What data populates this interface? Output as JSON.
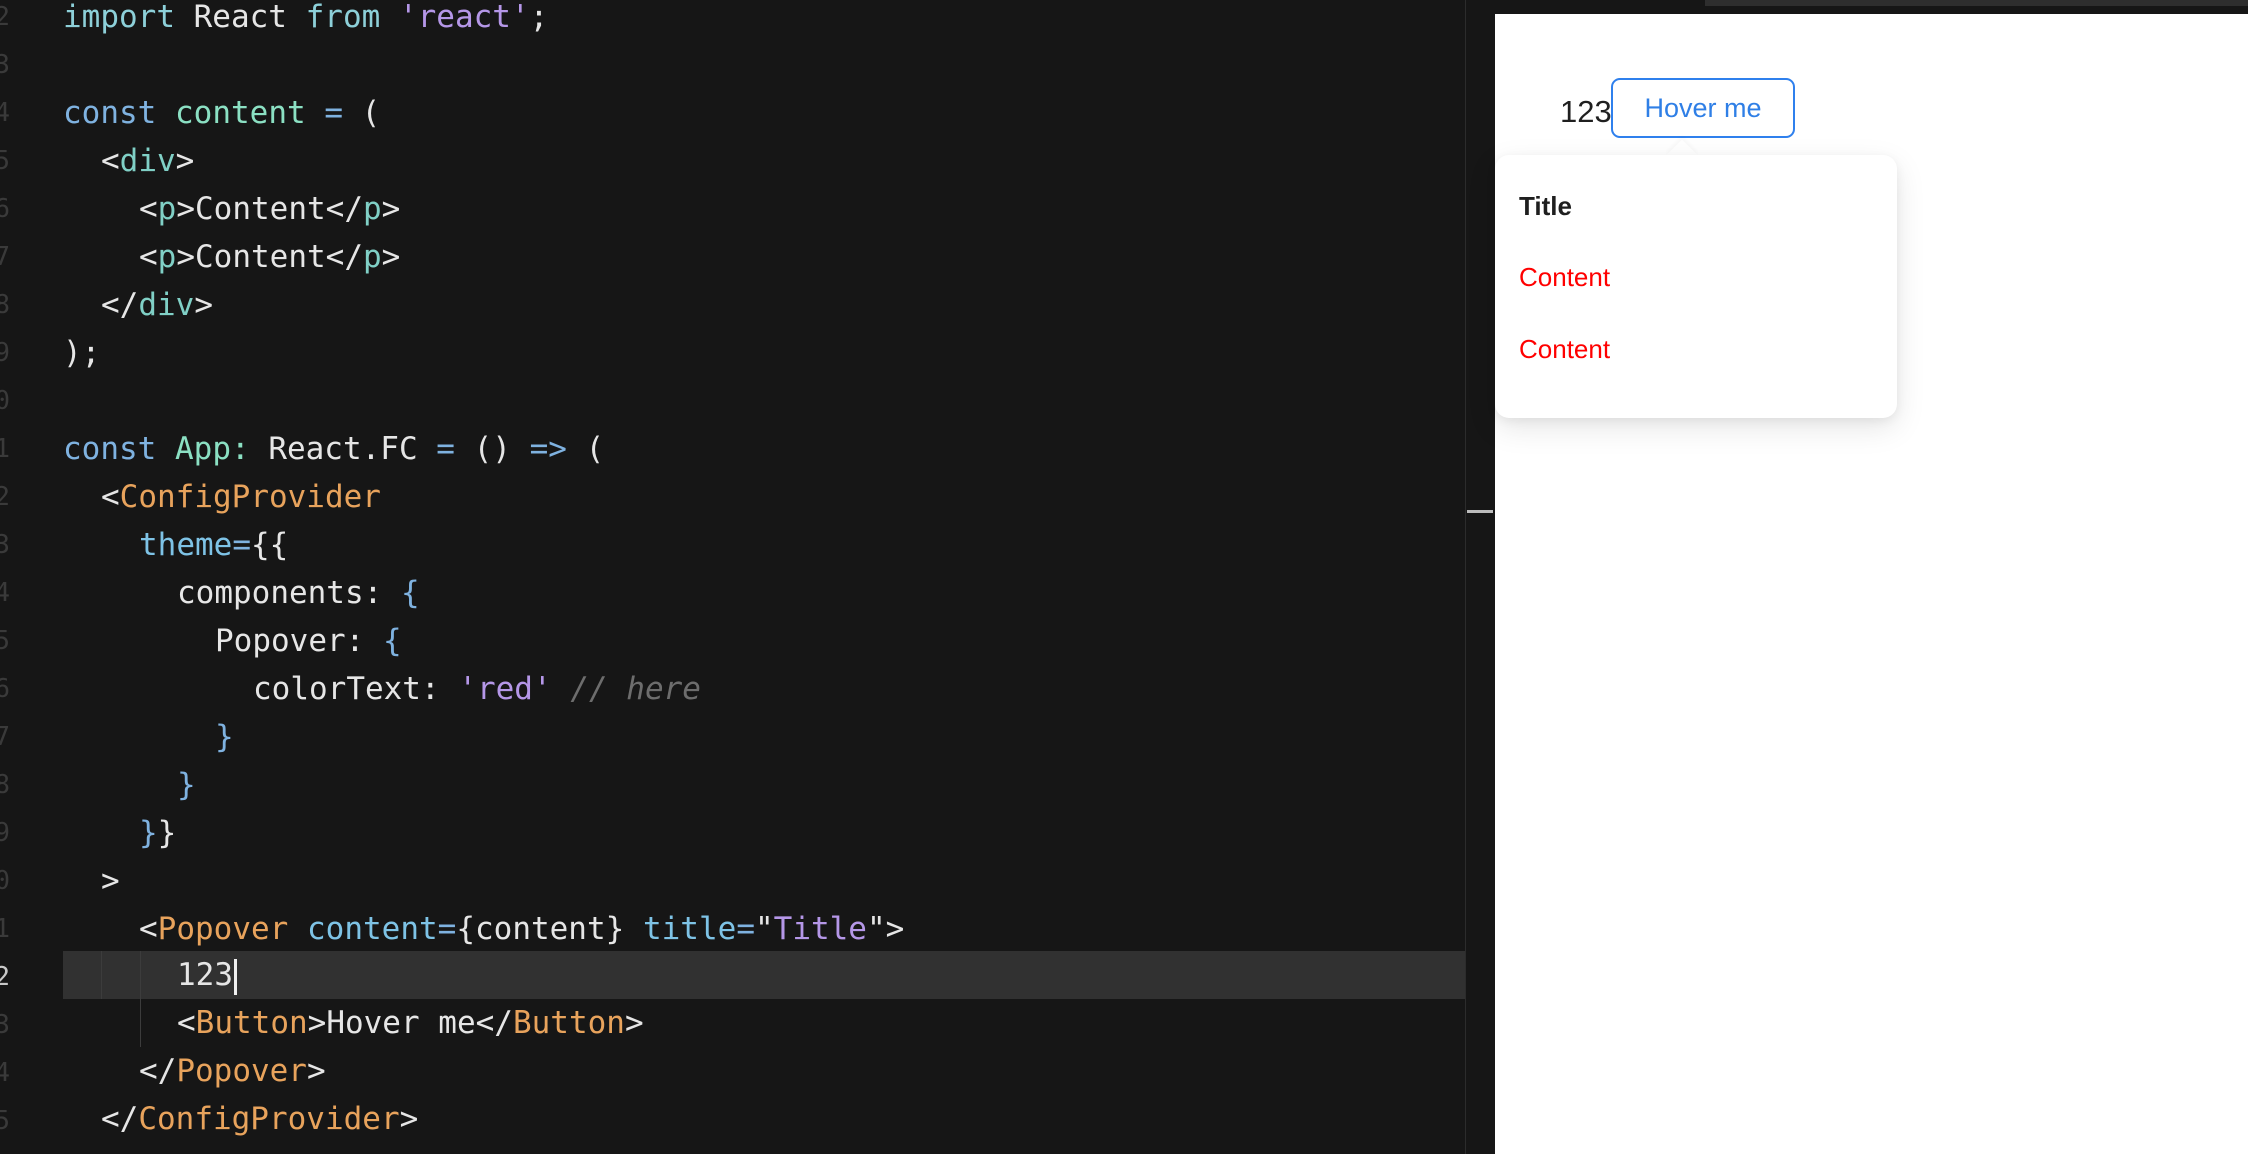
{
  "editor": {
    "gutter": {
      "line_numbers": [
        "2",
        "3",
        "4",
        "5",
        "6",
        "7",
        "8",
        "9",
        "0",
        "1",
        "2",
        "3",
        "4",
        "5",
        "6",
        "7",
        "8",
        "9",
        "0",
        "1",
        "2",
        "3",
        "4",
        "5"
      ],
      "active_line_number": "2"
    },
    "code": {
      "import_kw": "import",
      "import_name": " React ",
      "from_kw": "from",
      "import_src": "'react'",
      "import_end": ";",
      "const_kw": "const",
      "content_var": "content",
      "eq": "=",
      "open_paren": "(",
      "div_open_lt": "<",
      "div_tag": "div",
      "div_open_gt": ">",
      "p_lt": "<",
      "p_tag": "p",
      "p_text": ">Content</",
      "p_close_gt": ">",
      "div_close_lt": "</",
      "div_close_gt": ">",
      "close_paren": ");",
      "app_const": "const",
      "app_name": "App:",
      "app_type": " React.FC ",
      "app_eq": "=",
      "app_args": " () ",
      "app_arrow": "=>",
      "app_paren": " (",
      "config_lt": "<",
      "config_tag": "ConfigProvider",
      "theme_attr": "theme",
      "theme_eq": "=",
      "theme_open": "{{",
      "components_key": "components: ",
      "brace_open": "{",
      "popover_key": "Popover: ",
      "colortext_key": "colorText: ",
      "red_value": "'red'",
      "comment": "// here",
      "brace_close": "}",
      "theme_close_a": "}",
      "theme_close_b": "}",
      "gt": ">",
      "popover_lt": "<",
      "popover_tag": "Popover",
      "content_attr": "content",
      "content_eq": "=",
      "content_val": "{content}",
      "title_attr": "title",
      "title_eq": "=",
      "title_q1": "\"",
      "title_val": "Title",
      "title_q2": "\">",
      "num_line": "123",
      "button_lt": "<",
      "button_tag": "Button",
      "button_text": ">Hover me</",
      "button_close_gt": ">",
      "popover_close_lt": "</",
      "popover_close_gt": ">",
      "config_close_lt": "</",
      "config_close_gt": ">"
    }
  },
  "preview": {
    "number_text": "123",
    "button_label": "Hover me",
    "popover": {
      "title": "Title",
      "content_items": [
        "Content",
        "Content"
      ],
      "content_color": "#ff0000"
    },
    "accent_color": "#2f80ed"
  }
}
